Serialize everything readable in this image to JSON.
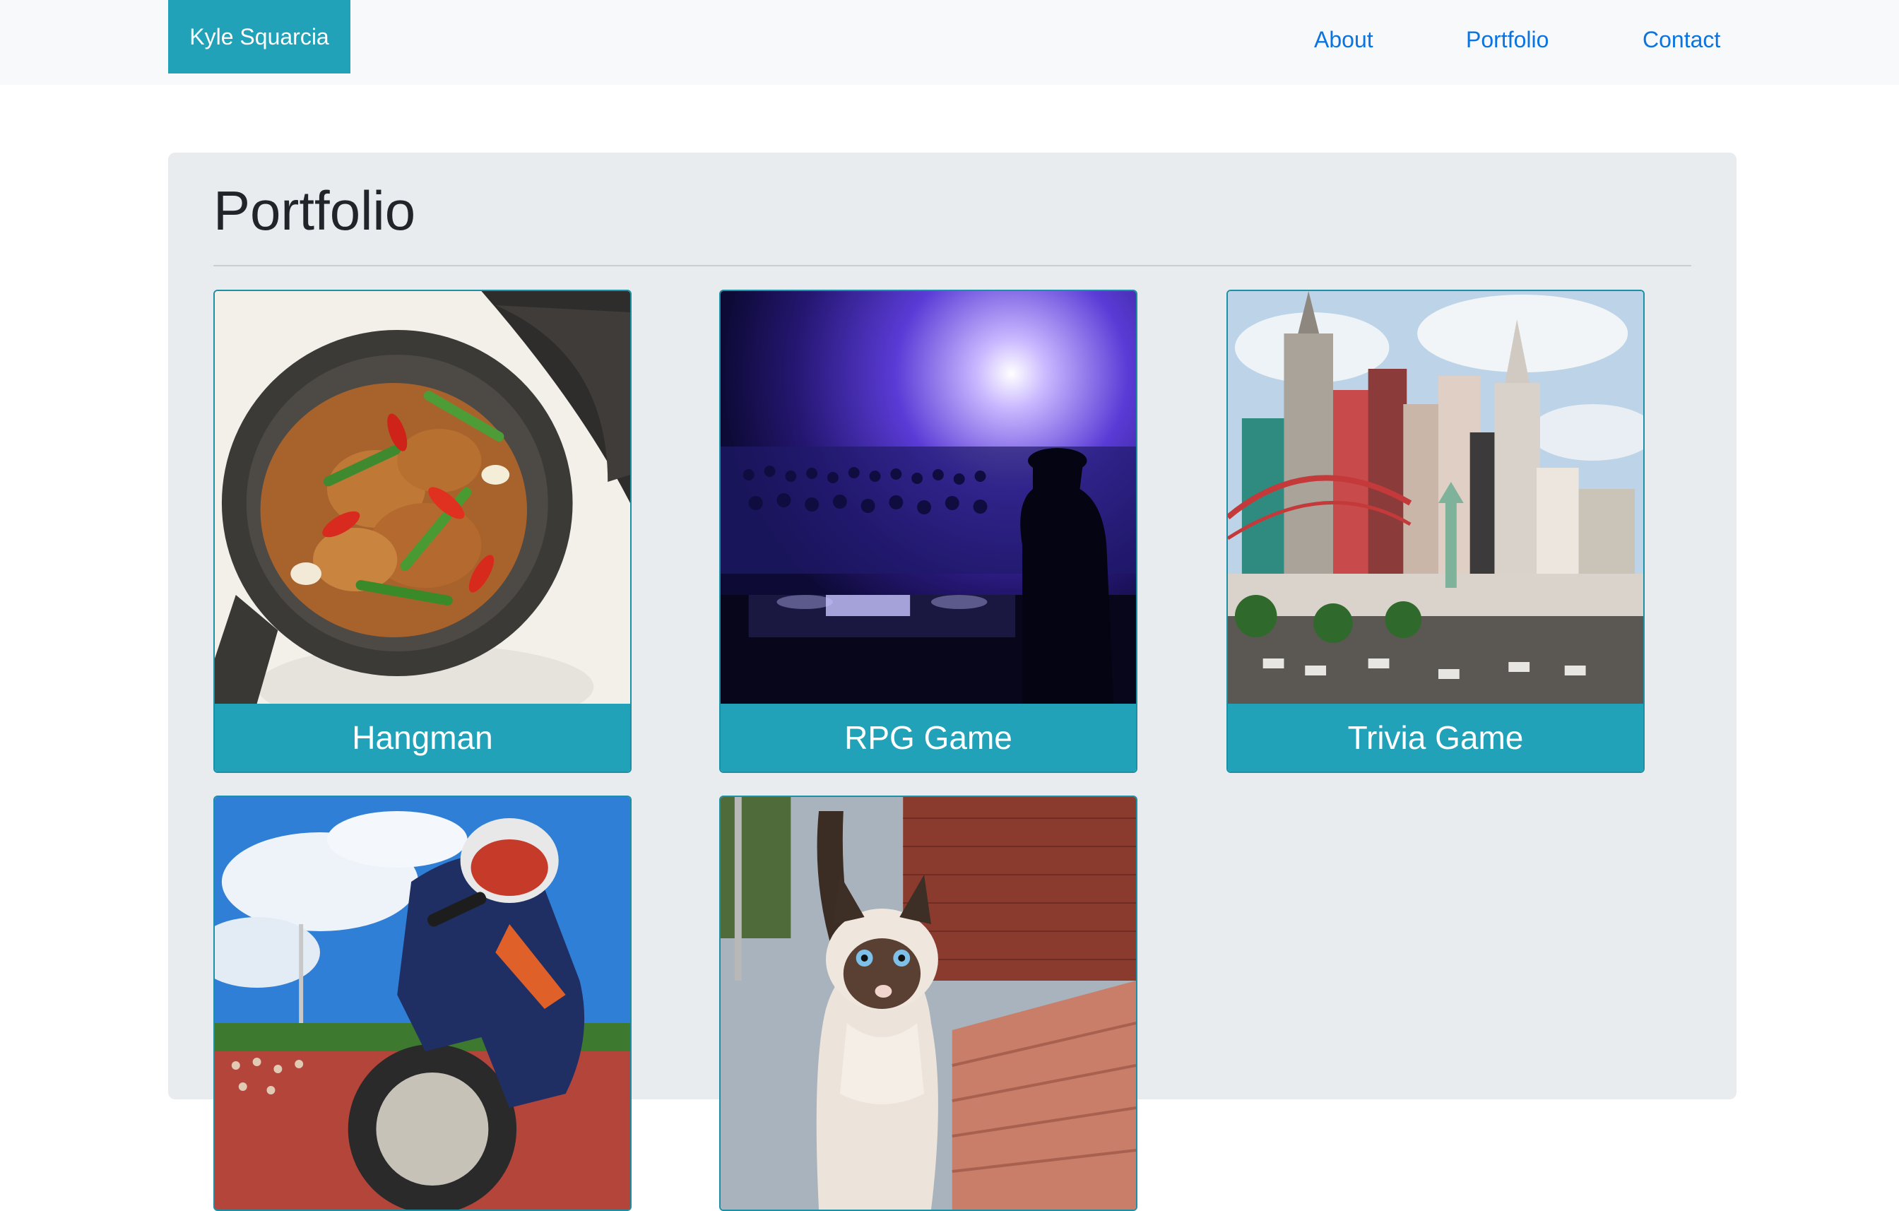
{
  "navbar": {
    "brand": "Kyle Squarcia",
    "links": [
      "About",
      "Portfolio",
      "Contact"
    ]
  },
  "main": {
    "title": "Portfolio",
    "projects": [
      {
        "label": "Hangman",
        "image": "stir-fry-in-pot"
      },
      {
        "label": "RPG Game",
        "image": "dj-concert-crowd"
      },
      {
        "label": "Trivia Game",
        "image": "las-vegas-skyline"
      },
      {
        "label": "",
        "image": "motocross-rider"
      },
      {
        "label": "",
        "image": "siamese-cat"
      }
    ]
  },
  "colors": {
    "brand_bg": "#21a2b8",
    "nav_link": "#0b74e0",
    "panel_bg": "#e9ecef",
    "navbar_bg": "#f8f9fa"
  }
}
